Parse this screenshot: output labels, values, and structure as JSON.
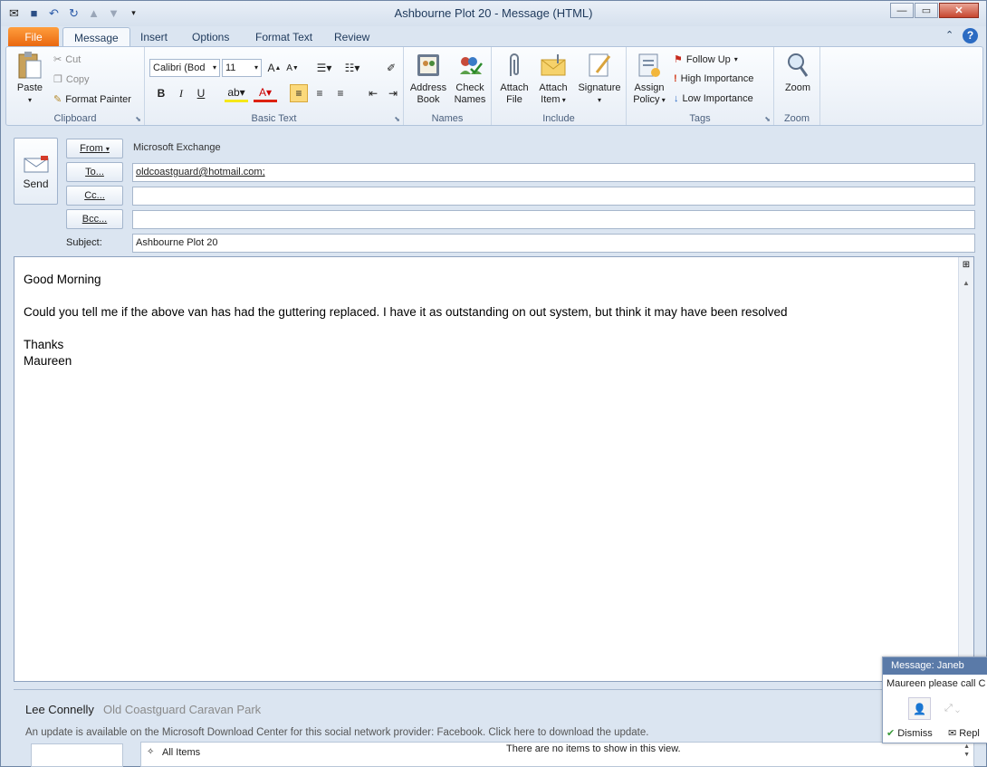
{
  "window": {
    "title": "Ashbourne Plot 20  -  Message (HTML)"
  },
  "tabs": [
    "File",
    "Message",
    "Insert",
    "Options",
    "Format Text",
    "Review"
  ],
  "ribbon": {
    "clipboard": {
      "paste": "Paste",
      "cut": "Cut",
      "copy": "Copy",
      "format_painter": "Format Painter",
      "label": "Clipboard"
    },
    "basic_text": {
      "font": "Calibri (Bod",
      "size": "11",
      "bold": "B",
      "italic": "I",
      "underline": "U",
      "label": "Basic Text"
    },
    "names": {
      "address_book": "Address Book",
      "check_names": "Check Names",
      "label": "Names"
    },
    "include": {
      "attach_file": "Attach File",
      "attach_item": "Attach Item",
      "signature": "Signature",
      "label": "Include"
    },
    "tags": {
      "assign_policy": "Assign Policy",
      "follow_up": "Follow Up",
      "high_importance": "High Importance",
      "low_importance": "Low Importance",
      "label": "Tags"
    },
    "zoom": {
      "zoom": "Zoom",
      "label": "Zoom"
    }
  },
  "compose": {
    "send": "Send",
    "from_label": "From",
    "from_value": "Microsoft Exchange",
    "to_label": "To...",
    "to_value": "oldcoastguard@hotmail.com;",
    "cc_label": "Cc...",
    "bcc_label": "Bcc...",
    "subject_label": "Subject:",
    "subject_value": "Ashbourne Plot 20"
  },
  "message_body": [
    "Good Morning",
    "",
    "Could you tell me if the above van has had the guttering replaced.  I have it as outstanding on out system, but think it may have been resolved",
    "",
    "Thanks",
    "Maureen"
  ],
  "people_pane": {
    "name": "Lee Connelly",
    "company": "Old Coastguard Caravan Park",
    "update_notice": "An update is available on the Microsoft Download Center for this social network provider: Facebook. Click here to download the update.",
    "filter": "All Items",
    "empty_text": "There are no items to show in this view."
  },
  "notification": {
    "header": "Message: Janeb",
    "text": "Maureen please call C",
    "dismiss": "Dismiss",
    "reply": "Repl"
  }
}
